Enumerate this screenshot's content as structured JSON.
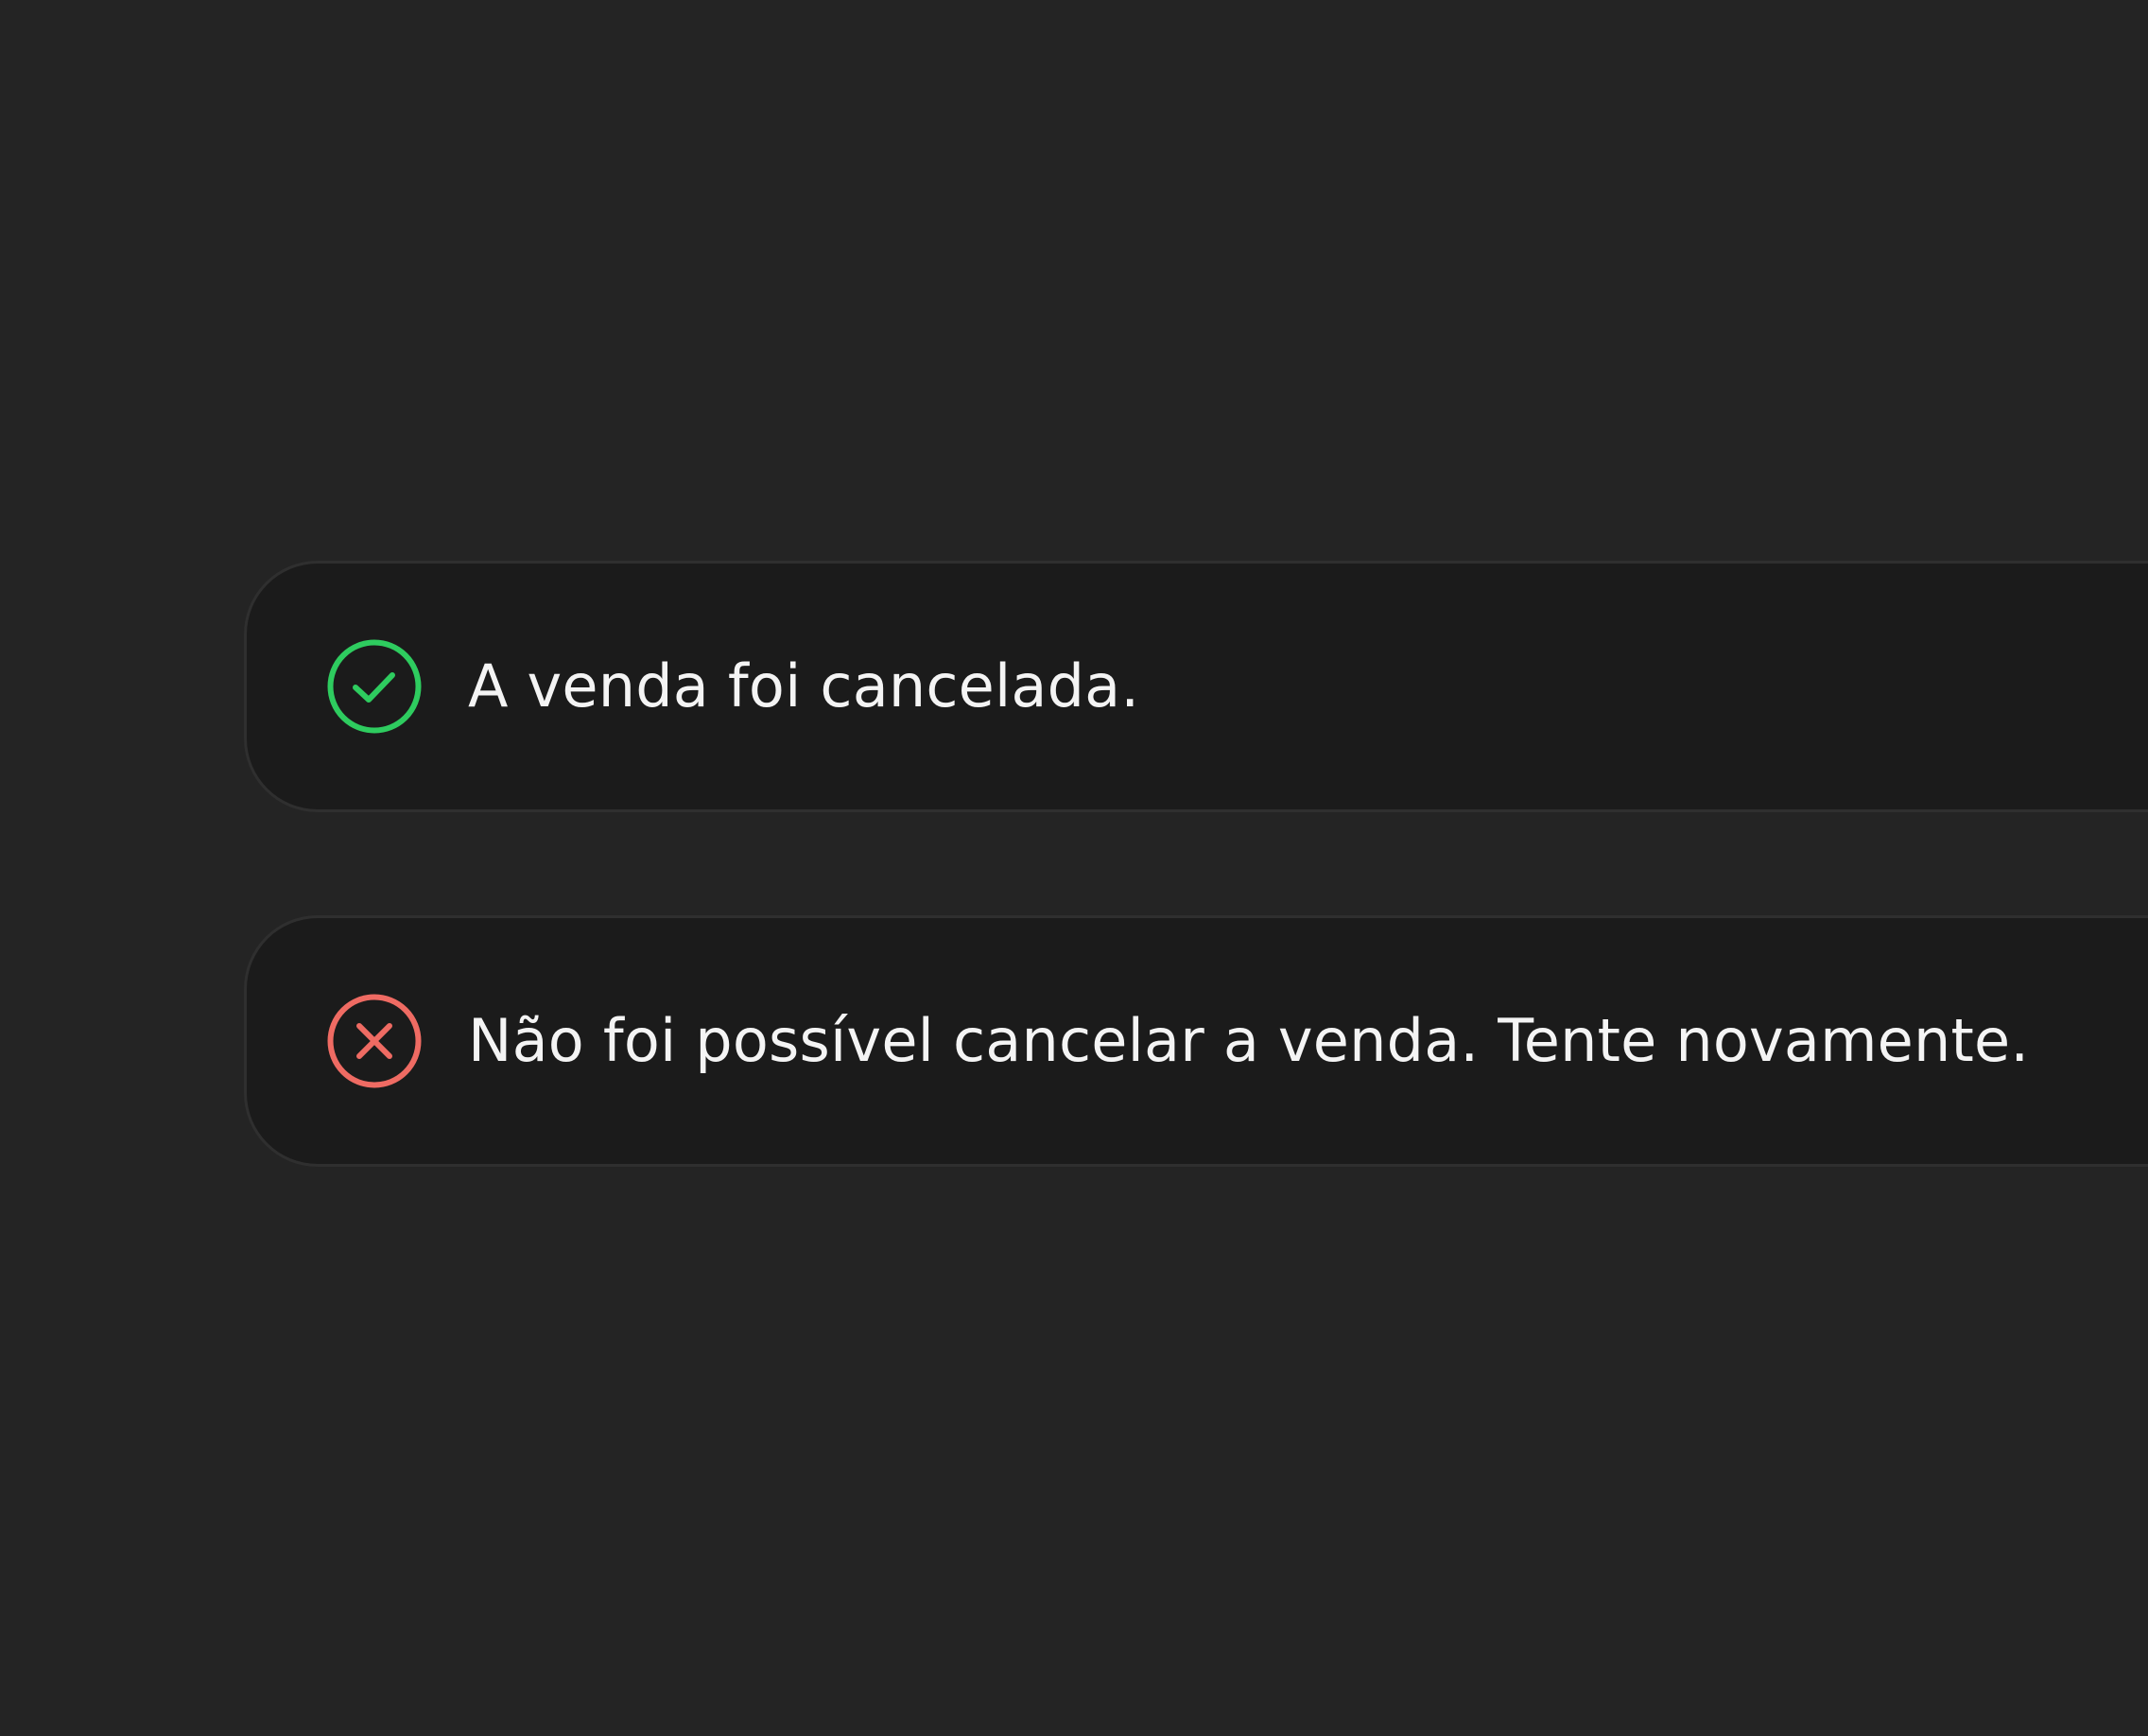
{
  "colors": {
    "background": "#242424",
    "toast_background": "#1b1b1b",
    "success": "#2ecc5f",
    "error": "#ef6b63",
    "text": "#f4f4f4"
  },
  "toasts": [
    {
      "variant": "success",
      "icon": "check-circle-icon",
      "message": "A venda foi cancelada."
    },
    {
      "variant": "error",
      "icon": "x-circle-icon",
      "message": "Não foi possível cancelar a venda. Tente novamente."
    }
  ]
}
